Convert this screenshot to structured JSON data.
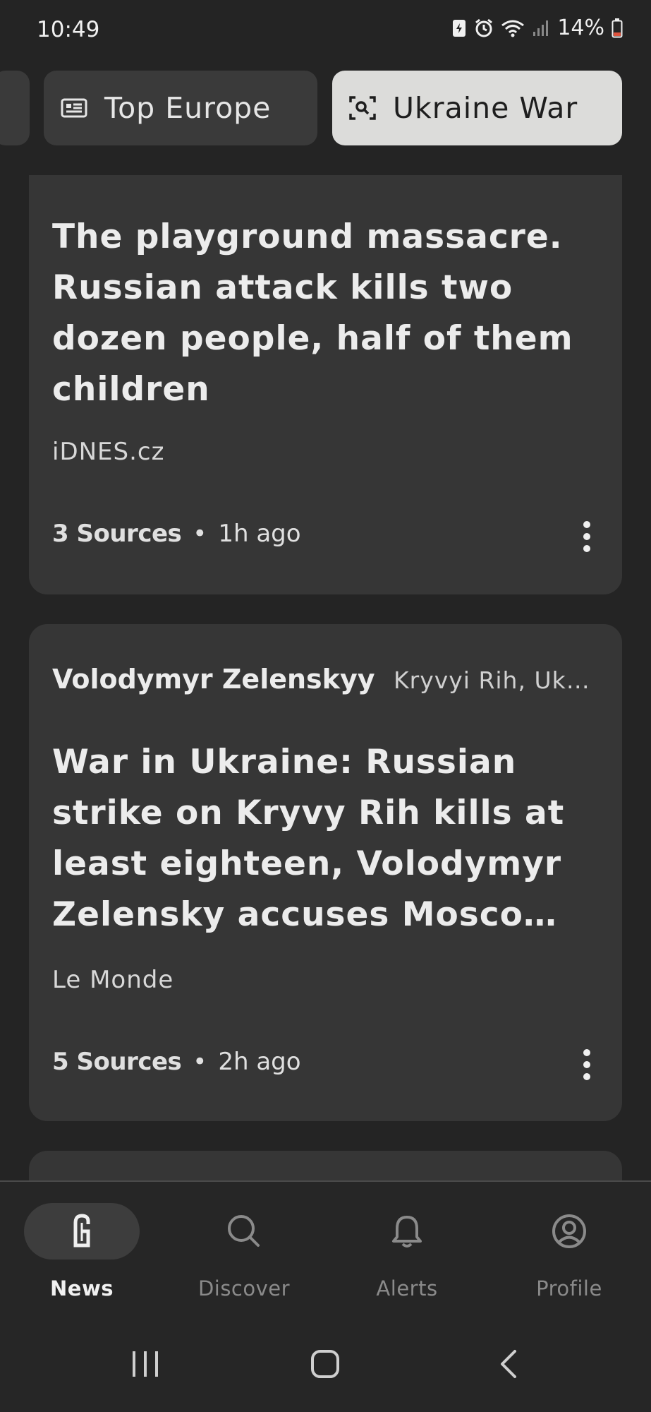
{
  "status_bar": {
    "time": "10:49",
    "battery": "14%"
  },
  "tabs": [
    {
      "label": "",
      "icon": "tab-partial"
    },
    {
      "label": "Top Europe",
      "icon": "newspaper-icon"
    },
    {
      "label": "Ukraine War",
      "icon": "focus-search-icon",
      "selected": true
    }
  ],
  "stories": [
    {
      "headline": "The playground massacre. Russian attack kills two dozen people, half of them children",
      "publisher": "iDNES.cz",
      "sources": "3 Sources",
      "time": "1h ago"
    },
    {
      "topic": "Volodymyr Zelenskyy",
      "location": "Kryvyi Rih, Uk…",
      "headline": "War in Ukraine: Russian strike on Kryvy Rih kills at least eighteen, Volodymyr Zelensky accuses Mosco…",
      "publisher": "Le Monde",
      "sources": "5 Sources",
      "time": "2h ago"
    }
  ],
  "separator": "•",
  "bottom_nav": [
    {
      "label": "News",
      "icon": "ground-news-logo-icon",
      "active": true
    },
    {
      "label": "Discover",
      "icon": "search-icon"
    },
    {
      "label": "Alerts",
      "icon": "bell-icon"
    },
    {
      "label": "Profile",
      "icon": "profile-icon"
    }
  ],
  "colors": {
    "background": "#242424",
    "card": "#363636",
    "selected_tab": "#dcdcda",
    "text": "#ececec",
    "muted": "#8a8a8a"
  }
}
